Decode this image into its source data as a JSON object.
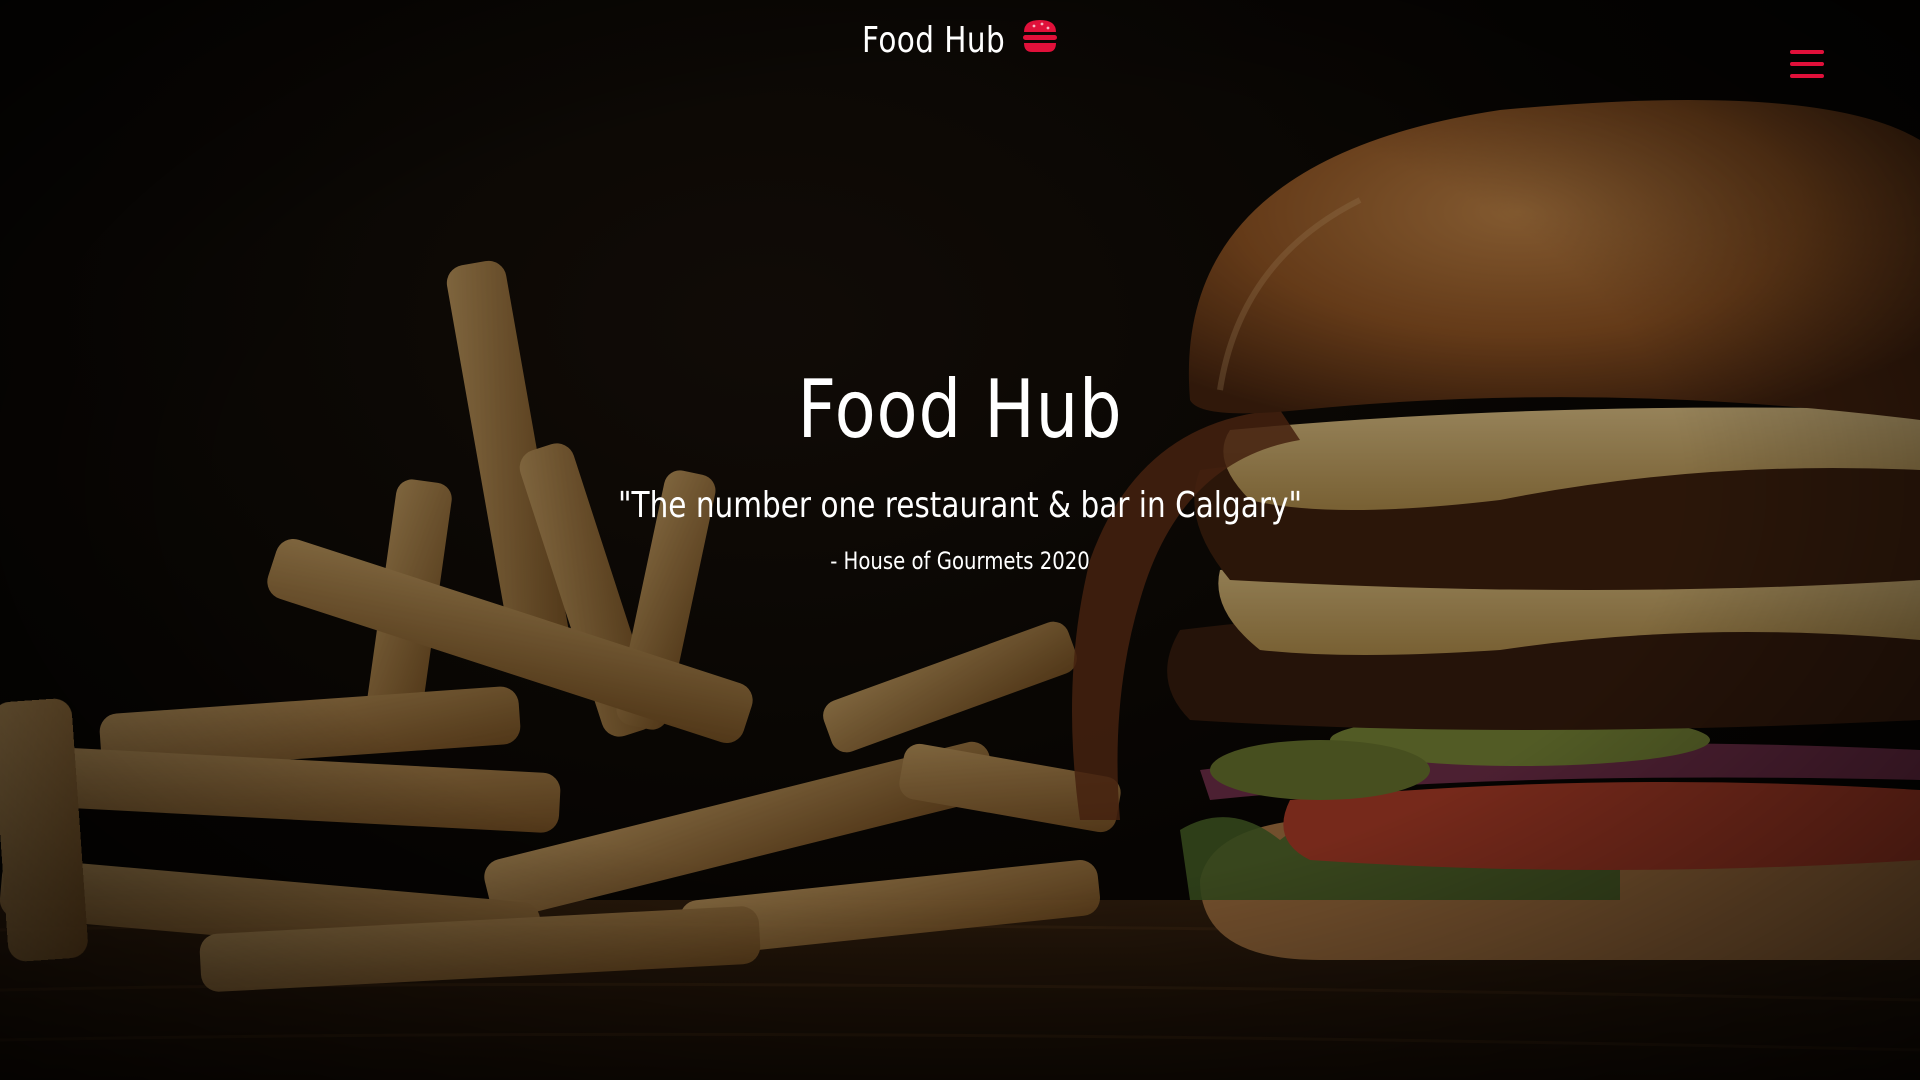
{
  "navbar": {
    "brand_text": "Food Hub",
    "brand_icon": "hamburger-icon",
    "menu_icon": "menu-icon"
  },
  "hero": {
    "title": "Food Hub",
    "quote": "\"The number one restaurant & bar in Calgary\"",
    "source": "- House of Gourmets 2020",
    "background": "burger-and-fries-photo"
  },
  "colors": {
    "accent": "#e0103a",
    "text": "#ffffff",
    "background": "#000000"
  }
}
